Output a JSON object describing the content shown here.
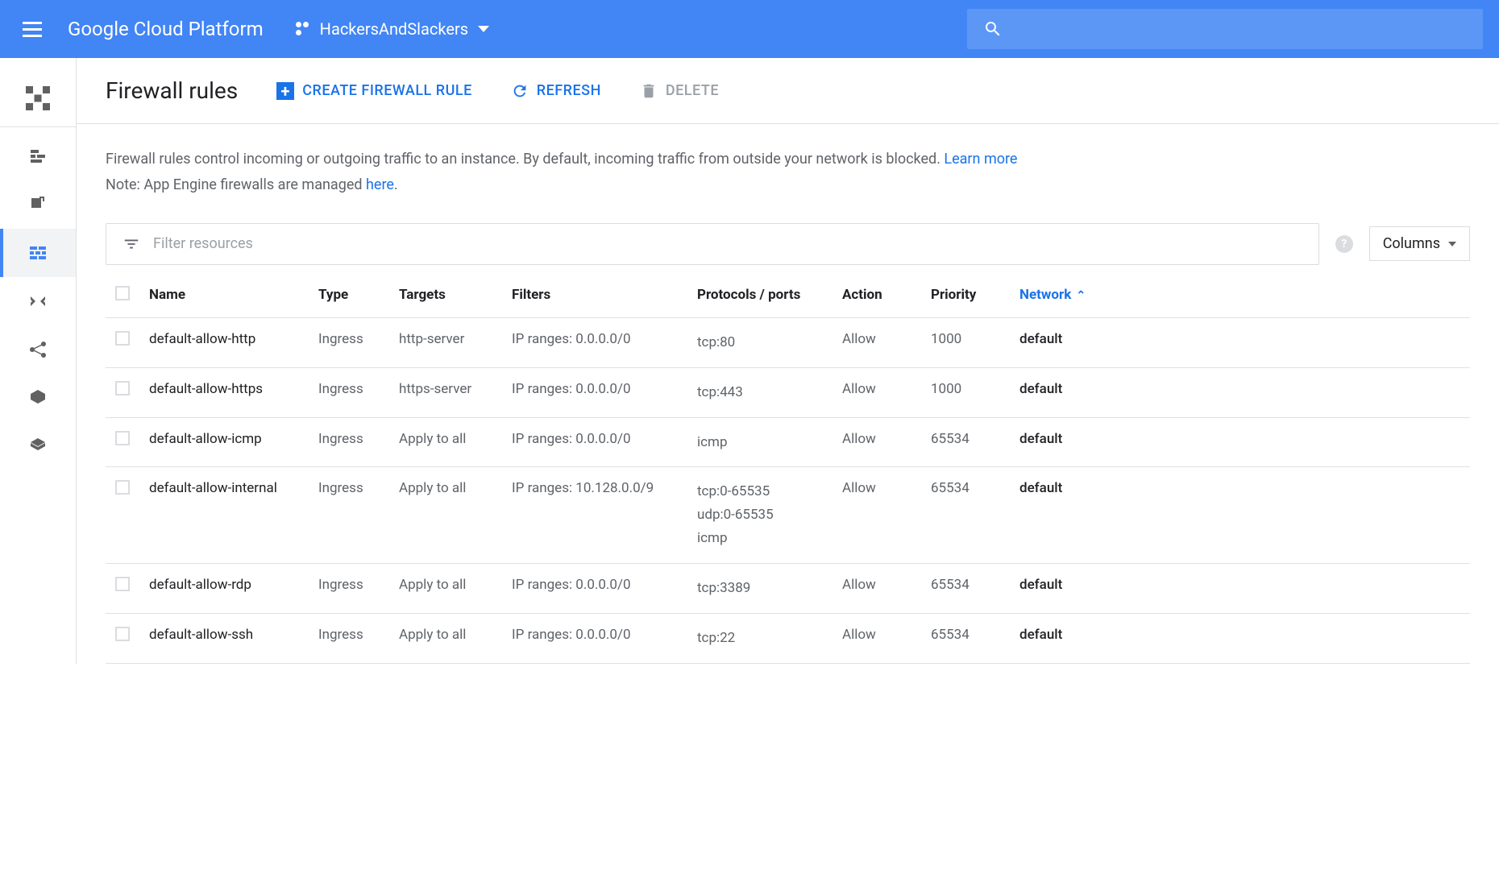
{
  "header": {
    "platform_name": "Google Cloud Platform",
    "project_name": "HackersAndSlackers"
  },
  "page": {
    "title": "Firewall rules",
    "actions": {
      "create": "CREATE FIREWALL RULE",
      "refresh": "REFRESH",
      "delete": "DELETE"
    },
    "description_line1": "Firewall rules control incoming or outgoing traffic to an instance. By default, incoming traffic from outside your network is blocked. ",
    "learn_more": "Learn more",
    "description_line2_prefix": "Note: App Engine firewalls are managed ",
    "here_text": "here",
    "description_line2_suffix": "."
  },
  "filter": {
    "placeholder": "Filter resources",
    "columns_label": "Columns"
  },
  "table": {
    "headers": {
      "name": "Name",
      "type": "Type",
      "targets": "Targets",
      "filters": "Filters",
      "protocols": "Protocols / ports",
      "action": "Action",
      "priority": "Priority",
      "network": "Network"
    },
    "rows": [
      {
        "name": "default-allow-http",
        "type": "Ingress",
        "targets": "http-server",
        "filters": "IP ranges: 0.0.0.0/0",
        "protocols": "tcp:80",
        "action": "Allow",
        "priority": "1000",
        "network": "default"
      },
      {
        "name": "default-allow-https",
        "type": "Ingress",
        "targets": "https-server",
        "filters": "IP ranges: 0.0.0.0/0",
        "protocols": "tcp:443",
        "action": "Allow",
        "priority": "1000",
        "network": "default"
      },
      {
        "name": "default-allow-icmp",
        "type": "Ingress",
        "targets": "Apply to all",
        "filters": "IP ranges: 0.0.0.0/0",
        "protocols": "icmp",
        "action": "Allow",
        "priority": "65534",
        "network": "default"
      },
      {
        "name": "default-allow-internal",
        "type": "Ingress",
        "targets": "Apply to all",
        "filters": "IP ranges: 10.128.0.0/9",
        "protocols": "tcp:0-65535\nudp:0-65535\nicmp",
        "action": "Allow",
        "priority": "65534",
        "network": "default"
      },
      {
        "name": "default-allow-rdp",
        "type": "Ingress",
        "targets": "Apply to all",
        "filters": "IP ranges: 0.0.0.0/0",
        "protocols": "tcp:3389",
        "action": "Allow",
        "priority": "65534",
        "network": "default"
      },
      {
        "name": "default-allow-ssh",
        "type": "Ingress",
        "targets": "Apply to all",
        "filters": "IP ranges: 0.0.0.0/0",
        "protocols": "tcp:22",
        "action": "Allow",
        "priority": "65534",
        "network": "default"
      }
    ]
  }
}
